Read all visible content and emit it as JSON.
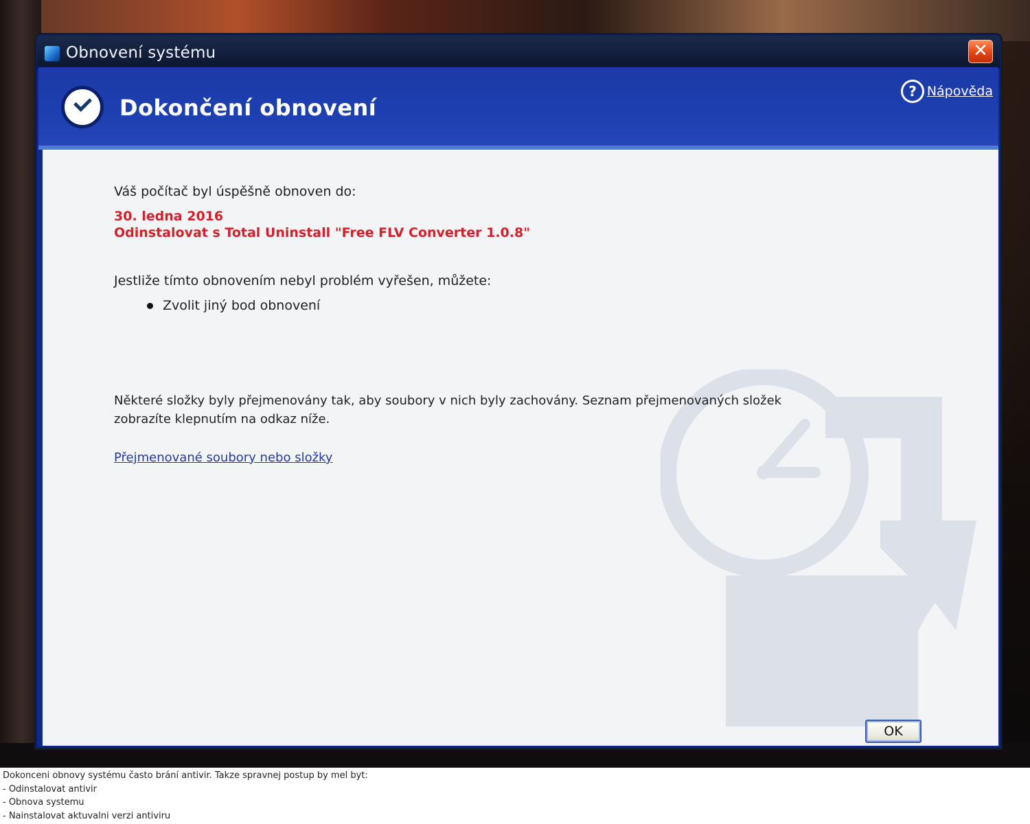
{
  "window": {
    "title": "Obnovení systému",
    "close_label": "✕"
  },
  "header": {
    "title": "Dokončení obnovení",
    "help_label": "Nápověda"
  },
  "content": {
    "intro": "Váš počítač byl úspěšně obnoven do:",
    "restore_date": "30. ledna 2016",
    "restore_description": "Odinstalovat s Total Uninstall \"Free FLV Converter 1.0.8\"",
    "not_solved": "Jestliže tímto obnovením nebyl problém vyřešen, můžete:",
    "options": [
      "Zvolit jiný bod obnovení"
    ],
    "renamed_note": "Některé složky byly přejmenovány tak, aby soubory v nich byly zachovány. Seznam přejmenovaných složek zobrazíte klepnutím na odkaz níže.",
    "renamed_link": "Přejmenované soubory nebo složky",
    "ok_label": "OK"
  },
  "caption": {
    "lines": [
      "Dokonceni obnovy systému často brání antivir. Takze spravnej postup by mel byt:",
      "- Odinstalovat antivir",
      "- Obnova systemu",
      "- Nainstalovat aktuvalni verzi antiviru"
    ]
  },
  "colors": {
    "header_blue": "#1d3fb0",
    "highlight_red": "#d4202a",
    "link_blue": "#233a9a"
  },
  "icons": {
    "title": "system-restore-icon",
    "header": "checkmark-icon",
    "help": "help-icon",
    "watermark": "clock-restore-icon"
  }
}
